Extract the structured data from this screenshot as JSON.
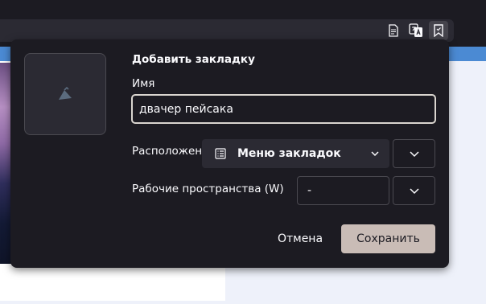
{
  "toolbar": {
    "icons": [
      "reader-view-icon",
      "translate-icon",
      "bookmark-icon"
    ]
  },
  "bookmark_panel": {
    "title": "Добавить закладку",
    "name_label": "Имя",
    "name_value": "двачер пейсака",
    "folder_label": "Расположение",
    "folder_value": "Меню закладок",
    "workspace_label": "Рабочие пространства (W)",
    "workspace_value": "-",
    "cancel_label": "Отмена",
    "save_label": "Сохранить"
  },
  "colors": {
    "panel_background": "#1c1b22",
    "field_background": "#2b2a33",
    "save_button": "#c9bcb6",
    "page_accent": "#4b8ad3"
  }
}
